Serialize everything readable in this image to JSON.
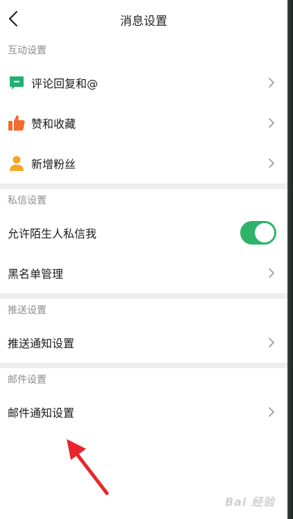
{
  "header": {
    "title": "消息设置"
  },
  "sections": {
    "interaction": {
      "label": "互动设置",
      "items": [
        {
          "label": "评论回复和@"
        },
        {
          "label": "赞和收藏"
        },
        {
          "label": "新增粉丝"
        }
      ]
    },
    "private_message": {
      "label": "私信设置",
      "allow_strangers_label": "允许陌生人私信我",
      "allow_strangers_enabled": true,
      "blacklist_label": "黑名单管理"
    },
    "push": {
      "label": "推送设置",
      "push_notification_label": "推送通知设置"
    },
    "mail": {
      "label": "邮件设置",
      "mail_notification_label": "邮件通知设置"
    }
  },
  "watermark": {
    "text": "Bai 经验"
  },
  "colors": {
    "toggle_on": "#2fb36a",
    "comment_icon": "#1fb174",
    "like_icon": "#f26a2e",
    "follower_icon": "#f5a623",
    "annotation_arrow": "#e8262c"
  }
}
